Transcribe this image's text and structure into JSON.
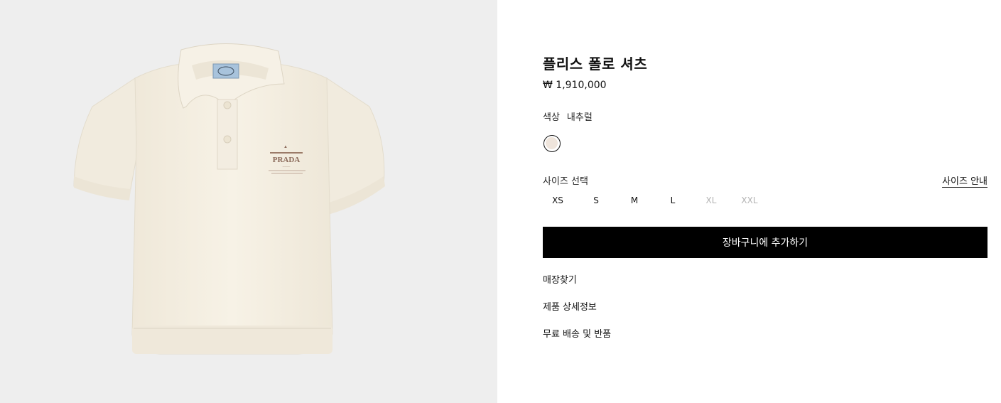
{
  "product": {
    "title": "플리스 폴로 셔츠",
    "price": "₩ 1,910,000",
    "image_alt": "Cream fleece polo shirt with PRADA logo",
    "logo_text": "PRADA"
  },
  "color": {
    "label": "색상",
    "selected": "내추럴",
    "swatch_color": "#efe5dc"
  },
  "size": {
    "label": "사이즈 선택",
    "guide_label": "사이즈 안내",
    "options": [
      {
        "label": "XS",
        "available": true
      },
      {
        "label": "S",
        "available": true
      },
      {
        "label": "M",
        "available": true
      },
      {
        "label": "L",
        "available": true
      },
      {
        "label": "XL",
        "available": false
      },
      {
        "label": "XXL",
        "available": false
      }
    ]
  },
  "actions": {
    "add_to_cart": "장바구니에 추가하기"
  },
  "links": {
    "find_store": "매장찾기",
    "product_details": "제품 상세정보",
    "shipping_returns": "무료 배송 및 반품"
  },
  "colors": {
    "accent": "#000000",
    "background": "#ffffff",
    "image_background": "#eeeeee",
    "shirt": "#f5f0e3",
    "disabled_text": "#b3b3b3"
  }
}
